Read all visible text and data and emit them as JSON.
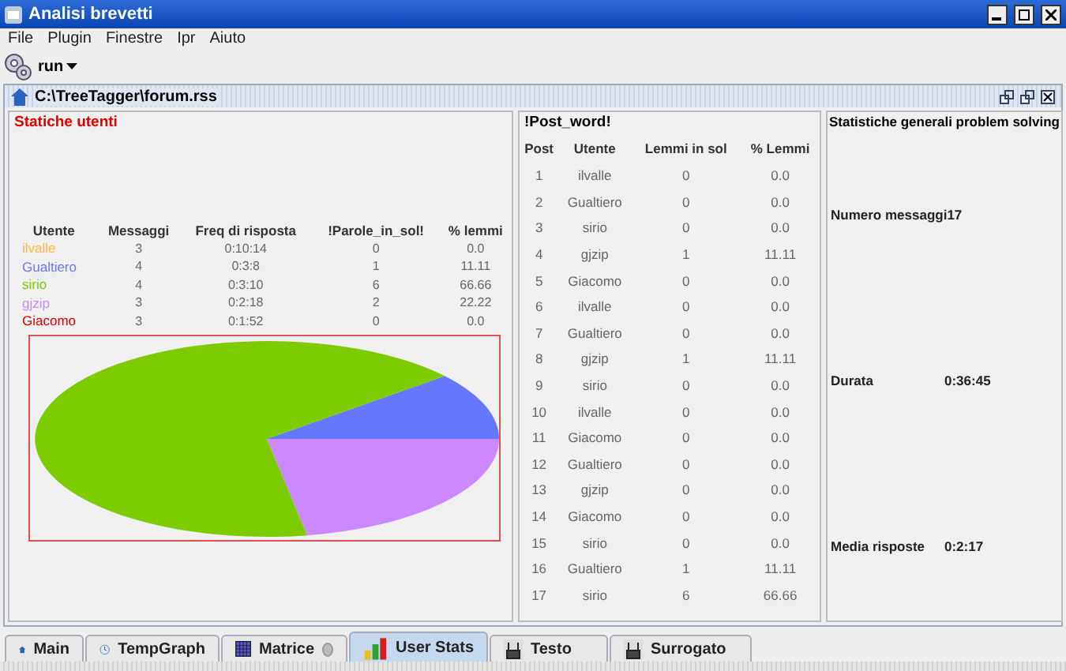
{
  "window": {
    "title": "Analisi brevetti"
  },
  "menu": [
    "File",
    "Plugin",
    "Finestre",
    "Ipr",
    "Aiuto"
  ],
  "toolbar": {
    "run_label": "run"
  },
  "document": {
    "title": "C:\\TreeTagger\\forum.rss"
  },
  "user_stats": {
    "title": "Statiche utenti",
    "columns": [
      "Utente",
      "Messaggi",
      "Freq di risposta",
      "!Parole_in_sol!",
      "% lemmi"
    ],
    "rows": [
      {
        "user": "ilvalle",
        "color": "#ffb833",
        "messages": "3",
        "freq": "0:10:14",
        "words": "0",
        "pct": "0.0"
      },
      {
        "user": "Gualtiero",
        "color": "#6677ff",
        "messages": "4",
        "freq": "0:3:8",
        "words": "1",
        "pct": "11.11"
      },
      {
        "user": "sirio",
        "color": "#7ccc00",
        "messages": "4",
        "freq": "0:3:10",
        "words": "6",
        "pct": "66.66"
      },
      {
        "user": "gjzip",
        "color": "#cc88ff",
        "messages": "3",
        "freq": "0:2:18",
        "words": "2",
        "pct": "22.22"
      },
      {
        "user": "Giacomo",
        "color": "#dd0000",
        "messages": "3",
        "freq": "0:1:52",
        "words": "0",
        "pct": "0.0"
      }
    ]
  },
  "post_word": {
    "title": "!Post_word!",
    "columns": [
      "Post",
      "Utente",
      "Lemmi in sol",
      "% Lemmi"
    ],
    "rows": [
      [
        "1",
        "ilvalle",
        "0",
        "0.0"
      ],
      [
        "2",
        "Gualtiero",
        "0",
        "0.0"
      ],
      [
        "3",
        "sirio",
        "0",
        "0.0"
      ],
      [
        "4",
        "gjzip",
        "1",
        "11.11"
      ],
      [
        "5",
        "Giacomo",
        "0",
        "0.0"
      ],
      [
        "6",
        "ilvalle",
        "0",
        "0.0"
      ],
      [
        "7",
        "Gualtiero",
        "0",
        "0.0"
      ],
      [
        "8",
        "gjzip",
        "1",
        "11.11"
      ],
      [
        "9",
        "sirio",
        "0",
        "0.0"
      ],
      [
        "10",
        "ilvalle",
        "0",
        "0.0"
      ],
      [
        "11",
        "Giacomo",
        "0",
        "0.0"
      ],
      [
        "12",
        "Gualtiero",
        "0",
        "0.0"
      ],
      [
        "13",
        "gjzip",
        "0",
        "0.0"
      ],
      [
        "14",
        "Giacomo",
        "0",
        "0.0"
      ],
      [
        "15",
        "sirio",
        "0",
        "0.0"
      ],
      [
        "16",
        "Gualtiero",
        "1",
        "11.11"
      ],
      [
        "17",
        "sirio",
        "6",
        "66.66"
      ]
    ]
  },
  "general": {
    "title": "Statistiche generali problem solving",
    "items": [
      {
        "label": "Numero messaggi",
        "value": "17"
      },
      {
        "label": "Durata",
        "value": "0:36:45"
      },
      {
        "label": "Media risposte",
        "value": "0:2:17"
      }
    ]
  },
  "tabs": [
    {
      "label": "Main",
      "selected": false,
      "closable": false
    },
    {
      "label": "TempGraph",
      "selected": false,
      "closable": false
    },
    {
      "label": "Matrice",
      "selected": false,
      "closable": true
    },
    {
      "label": "User Stats",
      "selected": true,
      "closable": false
    },
    {
      "label": "Testo",
      "selected": false,
      "closable": false
    },
    {
      "label": "Surrogato",
      "selected": false,
      "closable": false
    }
  ]
}
